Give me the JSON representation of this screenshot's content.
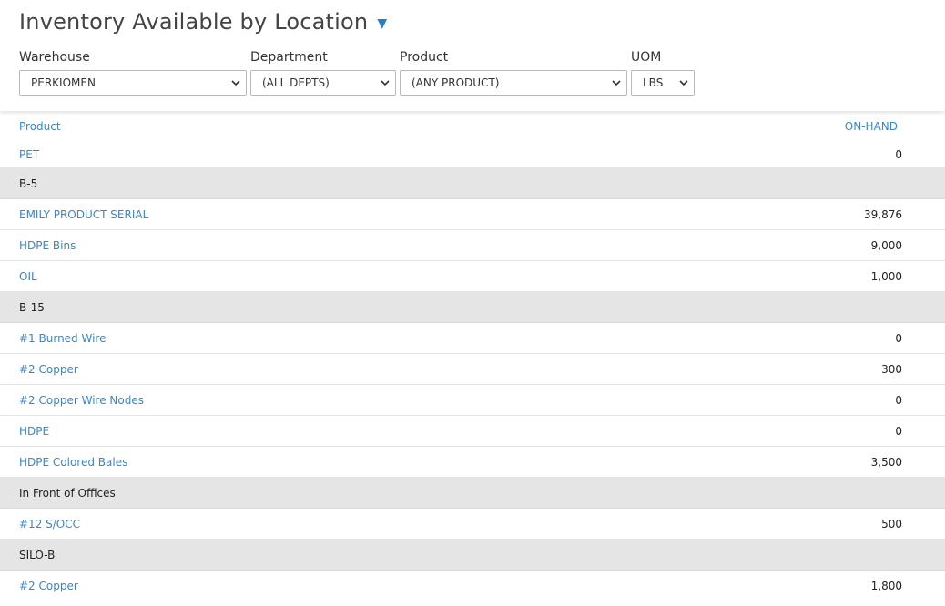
{
  "page": {
    "title": "Inventory Available by Location"
  },
  "filters": {
    "warehouse": {
      "label": "Warehouse",
      "value": "PERKIOMEN"
    },
    "department": {
      "label": "Department",
      "value": "(ALL DEPTS)"
    },
    "product": {
      "label": "Product",
      "value": "(ANY PRODUCT)"
    },
    "uom": {
      "label": "UOM",
      "value": "LBS"
    }
  },
  "table": {
    "columns": {
      "product": "Product",
      "on_hand": "ON-HAND"
    },
    "rows": [
      {
        "type": "item",
        "name": "PET",
        "qty": "0"
      },
      {
        "type": "group",
        "name": "B-5"
      },
      {
        "type": "item",
        "name": "EMILY PRODUCT SERIAL",
        "qty": "39,876"
      },
      {
        "type": "item",
        "name": "HDPE Bins",
        "qty": "9,000"
      },
      {
        "type": "item",
        "name": "OIL",
        "qty": "1,000"
      },
      {
        "type": "group",
        "name": "B-15"
      },
      {
        "type": "item",
        "name": "#1 Burned Wire",
        "qty": "0"
      },
      {
        "type": "item",
        "name": "#2 Copper",
        "qty": "300"
      },
      {
        "type": "item",
        "name": "#2 Copper Wire Nodes",
        "qty": "0"
      },
      {
        "type": "item",
        "name": "HDPE",
        "qty": "0"
      },
      {
        "type": "item",
        "name": "HDPE Colored Bales",
        "qty": "3,500"
      },
      {
        "type": "group",
        "name": "In Front of Offices"
      },
      {
        "type": "item",
        "name": "#12 S/OCC",
        "qty": "500"
      },
      {
        "type": "group",
        "name": "SILO-B"
      },
      {
        "type": "item",
        "name": "#2 Copper",
        "qty": "1,800"
      }
    ]
  },
  "colors": {
    "link": "#3a87c8",
    "group_row_bg": "#e5e5e5",
    "caret": "#2a7fc4"
  },
  "icons": {
    "title_caret": "caret-down-icon",
    "select_chevron": "chevron-down-icon"
  }
}
